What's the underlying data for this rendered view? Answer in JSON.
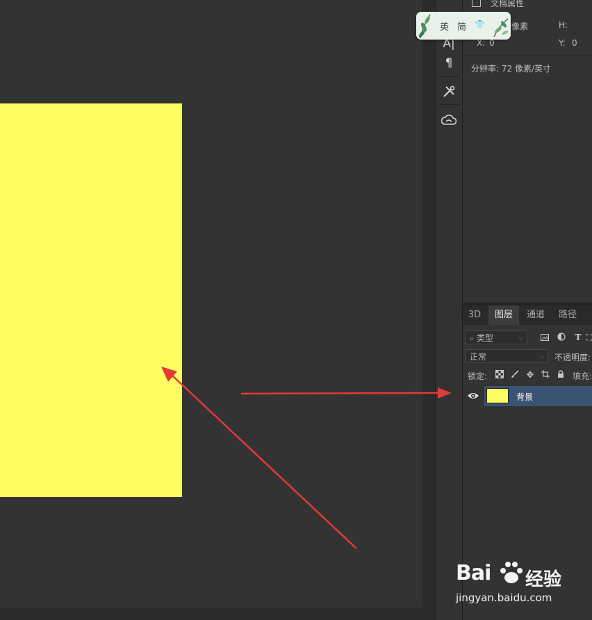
{
  "properties": {
    "title": "文档属性",
    "width_unit": "像素",
    "h_label": "H:",
    "x_label": "X:",
    "x_value": "0",
    "y_label": "Y:",
    "y_value": "0",
    "resolution": "分辨率: 72 像素/英寸"
  },
  "toolstrip": {
    "icons": [
      "type-tool-icon",
      "paragraph-icon",
      "tools-icon",
      "creative-cloud-icon"
    ],
    "type_glyph": "A|",
    "paragraph_glyph": "¶"
  },
  "ime": {
    "mode": "英",
    "script": "简",
    "skin_glyph": "👕"
  },
  "layers_panel": {
    "tabs": [
      "3D",
      "图层",
      "通道",
      "路径"
    ],
    "active_tab": "图层",
    "filter_placeholder": "类型",
    "blend_mode": "正常",
    "opacity_label": "不透明度:",
    "lock_label": "锁定:",
    "fill_label": "填充:",
    "layers": [
      {
        "name": "背景",
        "visible": true,
        "selected": true,
        "thumb_color": "#fdfd62"
      }
    ]
  },
  "colors": {
    "canvas_fill": "#fdfd62",
    "annotation_arrow": "#e53935",
    "selection": "#3b5270"
  },
  "watermark": {
    "brand": "Bai",
    "brand_suffix": "经验",
    "url": "jingyan.baidu.com"
  }
}
